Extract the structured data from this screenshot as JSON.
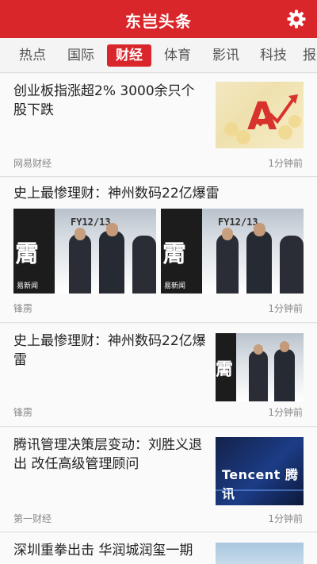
{
  "app": {
    "title": "东岂头条"
  },
  "tabs": [
    {
      "label": "热点"
    },
    {
      "label": "国际"
    },
    {
      "label": "财经"
    },
    {
      "label": "体育"
    },
    {
      "label": "影讯"
    },
    {
      "label": "科技"
    },
    {
      "label": "报"
    }
  ],
  "active_tab": "财经",
  "feed": {
    "items": [
      {
        "headline": "创业板指涨超2% 3000余只个股下跌",
        "source": "网易财经",
        "time": "1分钟前"
      },
      {
        "headline": "史上最惨理财：神州数码22亿爆雷",
        "source": "锋雳",
        "time": "1分钟前",
        "image_text": "FY12/13",
        "image_caption": "易新闻"
      },
      {
        "headline": "史上最惨理财：神州数码22亿爆雷",
        "source": "锋雳",
        "time": "1分钟前"
      },
      {
        "headline": "腾讯管理决策层变动：刘胜义退出 改任高级管理顾问",
        "source": "第一财经",
        "time": "1分钟前",
        "image_text": "Tencent 腾讯"
      },
      {
        "headline": "深圳重拳出击 华润城润玺一期",
        "source": "",
        "time": ""
      }
    ]
  },
  "colors": {
    "brand": "#d9262b",
    "background": "#f4f4f4",
    "text": "#222222",
    "meta": "#888888"
  }
}
